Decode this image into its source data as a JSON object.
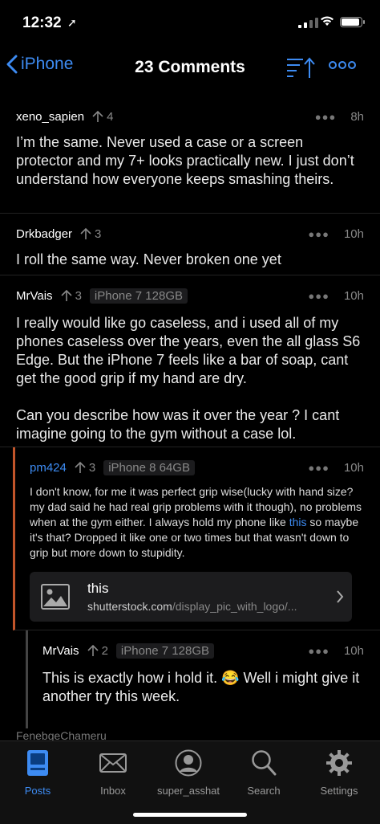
{
  "status": {
    "time": "12:32"
  },
  "nav": {
    "back_label": "iPhone",
    "title": "23 Comments"
  },
  "comments": [
    {
      "author": "xeno_sapien",
      "score": "4",
      "flair": "",
      "time": "8h",
      "body": "I’m the same. Never used a case or a screen protector and my 7+ looks practically new. I just don’t understand how everyone keeps smashing theirs."
    },
    {
      "author": "Drkbadger",
      "score": "3",
      "flair": "",
      "time": "10h",
      "body": "I roll the same way. Never broken one yet"
    },
    {
      "author": "MrVais",
      "score": "3",
      "flair": "iPhone 7 128GB",
      "time": "10h",
      "body": "I really would like go caseless, and i used all of my phones caseless over the years, even the all glass S6 Edge. But the iPhone 7 feels like a bar of soap, cant get the good grip if my hand are dry.",
      "body2": "Can you describe how was it over the year ? I cant imagine going to the gym without a case lol."
    },
    {
      "author": "pm424",
      "score": "3",
      "flair": "iPhone 8 64GB",
      "time": "10h",
      "body_pre": "I don't know, for me it was perfect grip wise(lucky with hand size? my dad said he had real grip problems with it though), no problems when at the gym either. I always hold my phone like ",
      "body_link": "this",
      "body_post": " so maybe it's that? Dropped it like one or two times but that wasn't down to grip but more down to stupidity.",
      "link_title": "this",
      "link_domain": "shutterstock.com",
      "link_path": "/display_pic_with_logo/..."
    },
    {
      "author": "MrVais",
      "score": "2",
      "flair": "iPhone 7 128GB",
      "time": "10h",
      "body": "This is exactly how i hold it. 😂 Well i might give it another try this week."
    }
  ],
  "peek_author": "FenebgeChameru",
  "tabs": [
    {
      "label": "Posts",
      "icon": "posts-icon"
    },
    {
      "label": "Inbox",
      "icon": "inbox-icon"
    },
    {
      "label": "super_asshat",
      "icon": "profile-icon"
    },
    {
      "label": "Search",
      "icon": "search-icon"
    },
    {
      "label": "Settings",
      "icon": "settings-icon"
    }
  ],
  "colors": {
    "accent": "#3d8bf2",
    "thread_line": "#c2552a",
    "background": "#000000"
  }
}
